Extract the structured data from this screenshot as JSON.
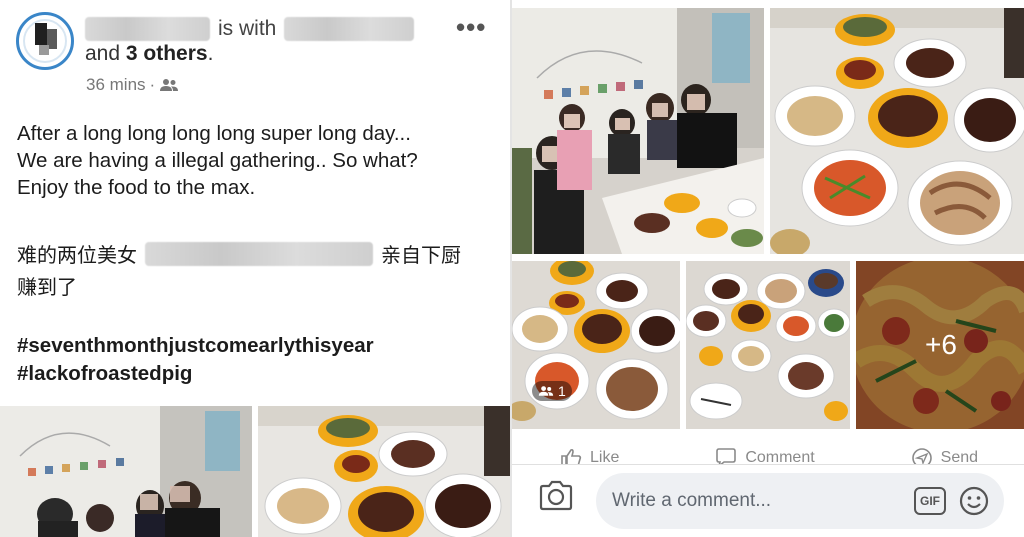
{
  "post": {
    "with_text": "is with",
    "and_text": "and",
    "others_count": "3 others",
    "period": ".",
    "time": "36 mins",
    "time_sep": "·",
    "more_icon": "more-dots-icon",
    "privacy_icon": "friends-icon",
    "text_lines": [
      "After a long long long long super long day...",
      "We are having a illegal gathering.. So what?",
      "Enjoy the food to the max."
    ],
    "cjk_prefix": "难的两位美女",
    "cjk_suffix": "亲自下厨",
    "cjk_line2": "赚到了",
    "hashtags": [
      "#seventhmonthjustcomearlythisyear",
      "#lackofroastedpig"
    ]
  },
  "gallery": {
    "more_count": "+6",
    "tagged_count": "1"
  },
  "actions": {
    "like": "Like",
    "comment": "Comment",
    "send": "Send"
  },
  "comment_bar": {
    "placeholder": "Write a comment...",
    "gif_label": "GIF"
  }
}
